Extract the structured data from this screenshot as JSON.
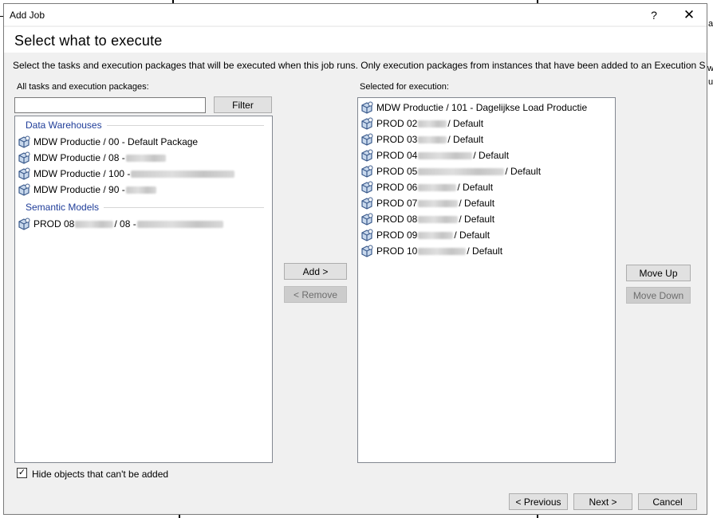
{
  "dialog": {
    "title": "Add Job",
    "help_glyph": "?",
    "close_glyph": "✕",
    "header": "Select what to execute",
    "description": "Select the tasks and execution packages that will be executed when this job runs. Only execution packages from instances that have been added to an Execution Server can be part"
  },
  "left": {
    "label": "All tasks and execution packages:",
    "filter_value": "",
    "filter_button": "Filter",
    "groups": [
      {
        "name": "Data Warehouses",
        "items": [
          {
            "text": "MDW Productie / 00 - Default Package",
            "blur": 0
          },
          {
            "text": "MDW Productie / 08 - ",
            "blur": 50
          },
          {
            "text": "MDW Productie / 100 - ",
            "blur": 130
          },
          {
            "text": "MDW Productie / 90 - ",
            "blur": 38
          }
        ]
      },
      {
        "name": "Semantic Models",
        "items": [
          {
            "text": "PROD 08",
            "blur": 48,
            "text2": " / 08 - ",
            "blur2": 108
          }
        ]
      }
    ]
  },
  "middle": {
    "add_button": "Add >",
    "remove_button": "< Remove"
  },
  "right": {
    "label": "Selected for execution:",
    "items": [
      {
        "prefix": "MDW Productie / 101 - Dagelijkse Load Productie",
        "blur": 0,
        "suffix": ""
      },
      {
        "prefix": "PROD 02",
        "blur": 36,
        "suffix": " / Default"
      },
      {
        "prefix": "PROD 03",
        "blur": 36,
        "suffix": " / Default"
      },
      {
        "prefix": "PROD 04",
        "blur": 68,
        "suffix": " / Default"
      },
      {
        "prefix": "PROD 05",
        "blur": 108,
        "suffix": " / Default"
      },
      {
        "prefix": "PROD 06",
        "blur": 48,
        "suffix": " / Default"
      },
      {
        "prefix": "PROD 07",
        "blur": 50,
        "suffix": " / Default"
      },
      {
        "prefix": "PROD 08",
        "blur": 50,
        "suffix": " / Default"
      },
      {
        "prefix": "PROD 09",
        "blur": 44,
        "suffix": " / Default"
      },
      {
        "prefix": "PROD 10",
        "blur": 60,
        "suffix": " / Default"
      }
    ],
    "move_up_button": "Move Up",
    "move_down_button": "Move Down"
  },
  "footer": {
    "hide_checkbox_label": "Hide objects that can't be added",
    "hide_checked": true,
    "check_glyph": "✓",
    "previous_button": "< Previous",
    "next_button": "Next >",
    "cancel_button": "Cancel"
  },
  "background": {
    "right_fragment_1": "a",
    "right_fragment_2": "wi",
    "right_fragment_3": "u"
  },
  "colors": {
    "group_header": "#1f3d99",
    "icon_fill": "#c8d8ec",
    "icon_stroke": "#3a5a8c"
  }
}
